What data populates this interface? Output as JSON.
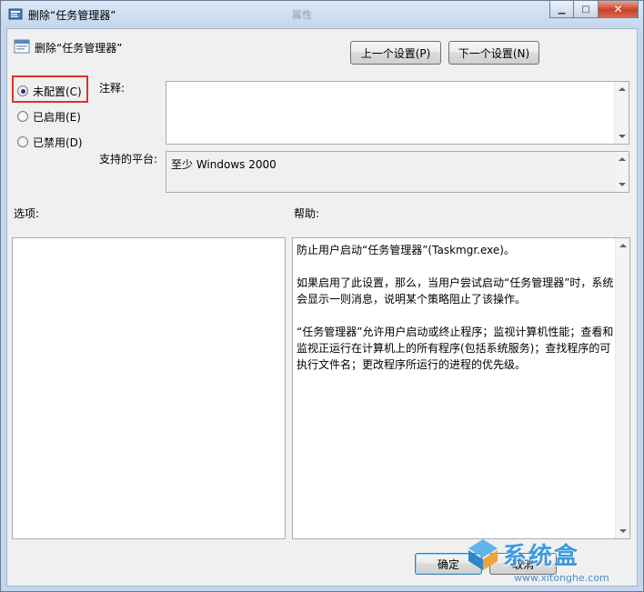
{
  "window": {
    "title": "删除“任务管理器”",
    "ghost_title_a": "删除“任务管理器”",
    "ghost_title_b": "属性"
  },
  "header": {
    "title": "删除“任务管理器”",
    "prev_button": "上一个设置(P)",
    "next_button": "下一个设置(N)"
  },
  "radios": [
    {
      "label": "未配置(C)",
      "checked": true
    },
    {
      "label": "已启用(E)",
      "checked": false
    },
    {
      "label": "已禁用(D)",
      "checked": false
    }
  ],
  "comment": {
    "label": "注释:",
    "value": ""
  },
  "platform": {
    "label": "支持的平台:",
    "value": "至少 Windows 2000"
  },
  "options": {
    "label": "选项:"
  },
  "help": {
    "label": "帮助:",
    "p1": "防止用户启动“任务管理器”(Taskmgr.exe)。",
    "p2": "如果启用了此设置，那么，当用户尝试启动“任务管理器”时，系统会显示一则消息，说明某个策略阻止了该操作。",
    "p3": "“任务管理器”允许用户启动或终止程序；监视计算机性能；查看和监视正运行在计算机上的所有程序(包括系统服务)；查找程序的可执行文件名；更改程序所运行的进程的优先级。"
  },
  "footer": {
    "ok_button": "确定",
    "cancel_button": "取消"
  },
  "watermark": {
    "name": "系统盒",
    "url": "www.xitonghe.com"
  },
  "colors": {
    "highlight": "#e0322a",
    "radio_dot": "#1a3f6b"
  }
}
